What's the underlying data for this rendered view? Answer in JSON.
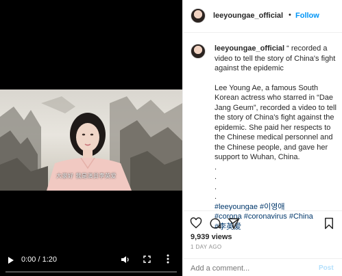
{
  "video": {
    "subtitle": "大家好 我是演员李英爱",
    "time": "0:00 / 1:20",
    "icons": {
      "play": "play-icon",
      "volume": "volume-icon",
      "fullscreen": "fullscreen-icon",
      "more": "more-vertical-icon"
    }
  },
  "post": {
    "username": "leeyoungae_official",
    "separator": "•",
    "follow_label": "Follow",
    "caption_user": "leeyoungae_official",
    "caption_quote": " “ recorded a video to tell the story of China's fight against the epidemic",
    "caption_body": "Lee Young Ae, a famous South Korean actress who starred in “Dae Jang Geum”, recorded a video to tell the story of China's fight against the epidemic. She paid her respects to the Chinese medical personnel and the Chinese people, and gave her support to Wuhan, China.",
    "dots": [
      ".",
      ".",
      ".",
      "."
    ],
    "hashtags_line1": "#leeyoungae #이영애",
    "hashtags_line2": "#corona #coronavirus #China",
    "hashtags_line3": "#李英爱",
    "views": "9,939 views",
    "posted": "1 DAY AGO",
    "comment_placeholder": "Add a comment...",
    "post_label": "Post"
  },
  "colors": {
    "link_blue": "#0095f6",
    "hashtag": "#00376b",
    "muted": "#8e8e8e"
  }
}
